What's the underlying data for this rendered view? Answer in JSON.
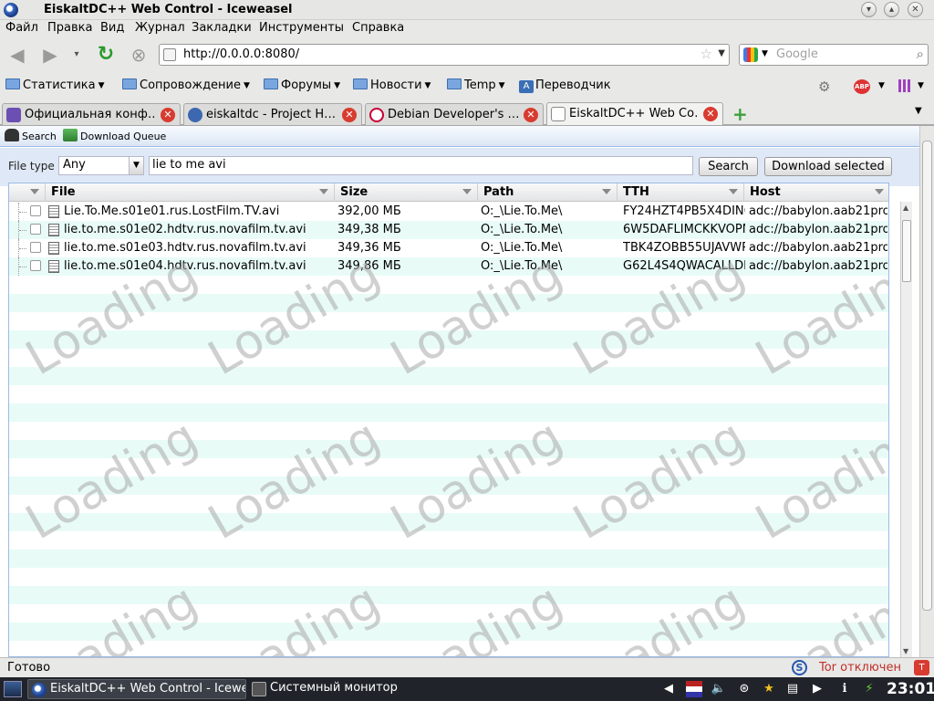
{
  "window": {
    "title": "EiskaltDC++ Web Control - Iceweasel"
  },
  "menu": [
    "Файл",
    "Правка",
    "Вид",
    "Журнал",
    "Закладки",
    "Инструменты",
    "Справка"
  ],
  "nav": {
    "url": "http://0.0.0.0:8080/",
    "search_placeholder": "Google"
  },
  "bookmarks": [
    {
      "label": "Статистика",
      "folder": true
    },
    {
      "label": "Сопровождение",
      "folder": true
    },
    {
      "label": "Форумы",
      "folder": true
    },
    {
      "label": "Новости",
      "folder": true
    },
    {
      "label": "Temp",
      "folder": true
    },
    {
      "label": "Переводчик",
      "folder": false
    }
  ],
  "tabs": [
    {
      "label": "Официальная конф…",
      "active": false
    },
    {
      "label": "eiskaltdc - Project H…",
      "active": false
    },
    {
      "label": "Debian Developer's …",
      "active": false
    },
    {
      "label": "EiskaltDC++ Web Co…",
      "active": true
    }
  ],
  "app": {
    "actions": {
      "search": "Search",
      "download_queue": "Download Queue"
    },
    "filetype_label": "File type",
    "filetype_value": "Any",
    "query": "lie to me avi",
    "search_button": "Search",
    "download_button": "Download selected",
    "columns": [
      "File",
      "Size",
      "Path",
      "TTH",
      "Host"
    ],
    "rows": [
      {
        "file": "Lie.To.Me.s01e01.rus.LostFilm.TV.avi",
        "size": "392,00 МБ",
        "path": "O:_\\Lie.To.Me\\",
        "tth": "FY24HZT4PB5X4DIN6",
        "host": "adc://babylon.aab21pro"
      },
      {
        "file": "lie.to.me.s01e02.hdtv.rus.novafilm.tv.avi",
        "size": "349,38 МБ",
        "path": "O:_\\Lie.To.Me\\",
        "tth": "6W5DAFLIMCKKVOPM",
        "host": "adc://babylon.aab21pro"
      },
      {
        "file": "lie.to.me.s01e03.hdtv.rus.novafilm.tv.avi",
        "size": "349,36 МБ",
        "path": "O:_\\Lie.To.Me\\",
        "tth": "TBK4ZOBB55UJAVWP",
        "host": "adc://babylon.aab21pro"
      },
      {
        "file": "lie.to.me.s01e04.hdtv.rus.novafilm.tv.avi",
        "size": "349,86 МБ",
        "path": "O:_\\Lie.To.Me\\",
        "tth": "G62L4S4QWACALLDE",
        "host": "adc://babylon.aab21pro"
      }
    ],
    "loading_text": "Loading"
  },
  "status": {
    "text": "Готово",
    "tor": "Tor отключен"
  },
  "taskbar": {
    "tasks": [
      {
        "label": "EiskaltDC++ Web Control - Icewea",
        "active": true
      },
      {
        "label": "Системный монитор",
        "active": false
      }
    ],
    "clock": "23:01"
  }
}
